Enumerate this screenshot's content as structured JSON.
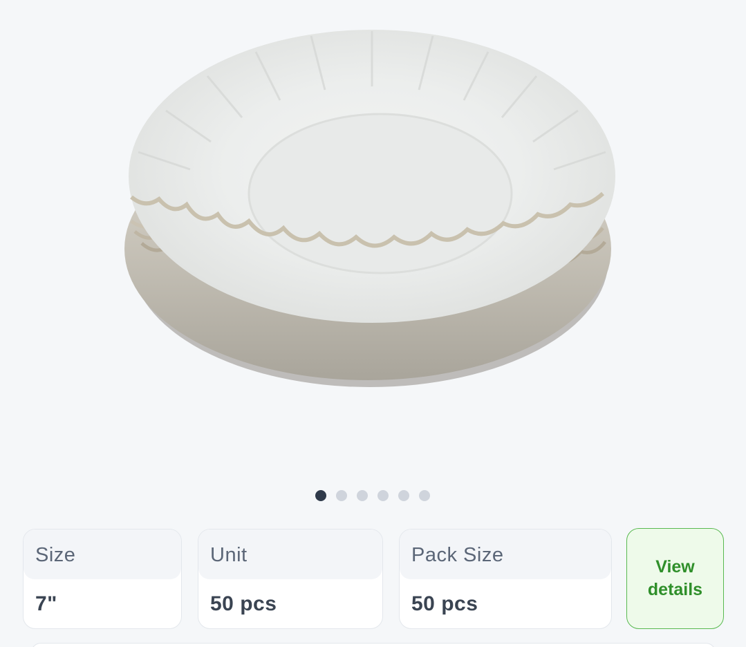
{
  "product": {
    "image_icon": "paper-plates-stack-image",
    "carousel": {
      "total": 6,
      "active_index": 0
    }
  },
  "attributes": [
    {
      "label": "Size",
      "value": "7\""
    },
    {
      "label": "Unit",
      "value": "50 pcs"
    },
    {
      "label": "Pack Size",
      "value": "50 pcs"
    }
  ],
  "view_details_label": "View details",
  "colors": {
    "background": "#f5f7f9",
    "dot_active": "#2f3a4a",
    "dot_inactive": "#cfd4dc",
    "button_border": "#58b94f",
    "button_text": "#2f8f2a",
    "button_bg": "#eefaea"
  }
}
